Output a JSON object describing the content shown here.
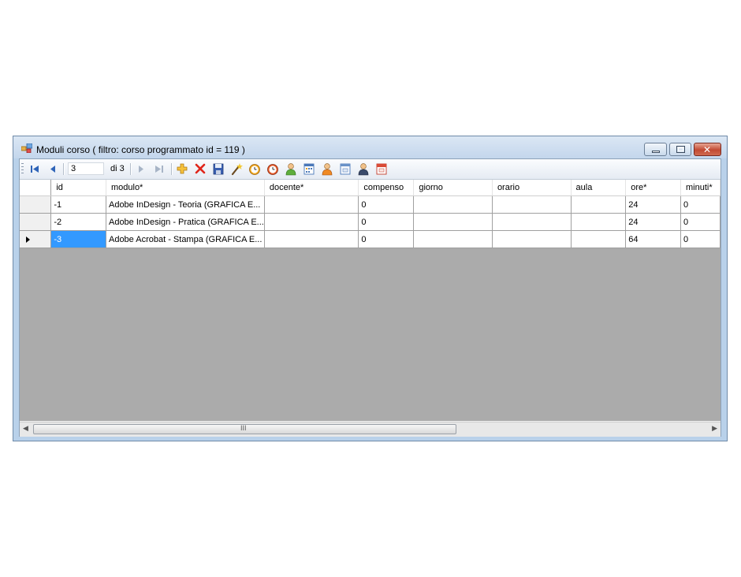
{
  "window": {
    "title": "Moduli corso ( filtro: corso programmato id = 119 )"
  },
  "navigator": {
    "position": "3",
    "count": "di 3"
  },
  "toolbar_icons": [
    "move-first-icon",
    "move-previous-icon",
    "move-next-icon",
    "move-last-icon",
    "add-new-icon",
    "delete-icon",
    "save-icon",
    "wizard-icon",
    "clock-icon",
    "alarm-clock-icon",
    "person-icon",
    "calendar-grid-icon",
    "person-orange-icon",
    "calendar-10-icon",
    "person-dark-icon",
    "calendar-12-icon"
  ],
  "grid": {
    "columns": [
      "id",
      "modulo*",
      "docente*",
      "compenso",
      "giorno",
      "orario",
      "aula",
      "ore*",
      "minuti*"
    ],
    "rows": [
      [
        "-1",
        "Adobe InDesign - Teoria (GRAFICA E...",
        "",
        "0",
        "",
        "",
        "",
        "24",
        "0"
      ],
      [
        "-2",
        "Adobe InDesign - Pratica (GRAFICA E...",
        "",
        "0",
        "",
        "",
        "",
        "24",
        "0"
      ],
      [
        "-3",
        "Adobe Acrobat - Stampa (GRAFICA E...",
        "",
        "0",
        "",
        "",
        "",
        "64",
        "0"
      ]
    ]
  },
  "scrollbar": {
    "grip": "III"
  },
  "colors": {
    "selection": "#3399ff",
    "grid_background": "#ababab",
    "frame": "#b9d1ea"
  }
}
